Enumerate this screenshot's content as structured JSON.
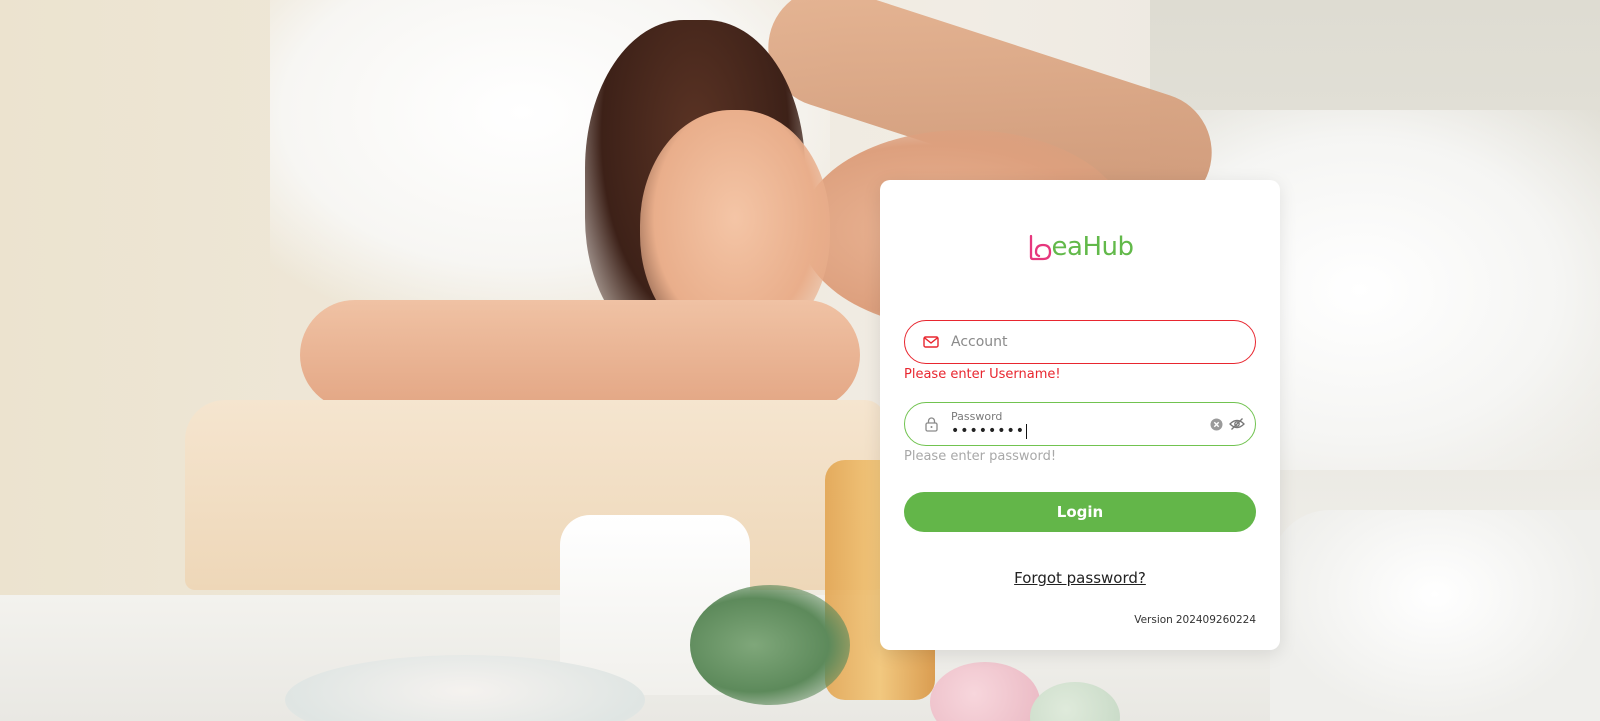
{
  "logo": {
    "text": "eaHub",
    "mark_icon": "leaf-heart-logo-icon",
    "brand_pink": "#e6377d",
    "brand_green": "#62b94a"
  },
  "account": {
    "placeholder": "Account",
    "value": "",
    "icon": "mail-icon",
    "error": "Please enter Username!",
    "border_color": "#e8262f"
  },
  "password": {
    "label": "Password",
    "masked_value": "••••••••",
    "icon": "lock-icon",
    "clear_icon": "clear-icon",
    "visibility_icon": "eye-off-icon",
    "hint": "Please enter password!",
    "border_color": "#71c350"
  },
  "login_button": {
    "label": "Login",
    "color": "#63b649"
  },
  "forgot_link": {
    "label": "Forgot password?"
  },
  "version": {
    "label": "Version",
    "value": "202409260224"
  }
}
